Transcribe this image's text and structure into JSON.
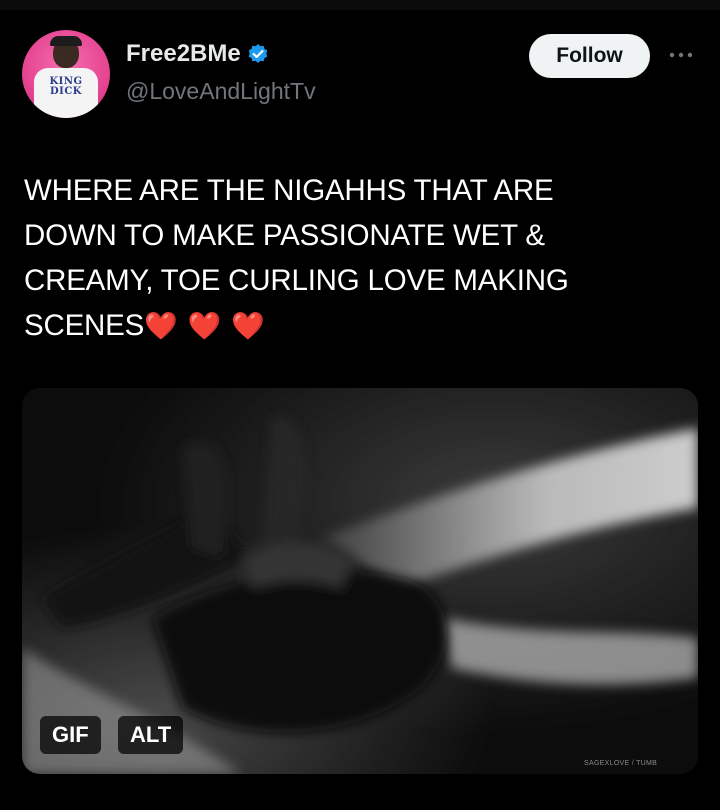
{
  "user": {
    "display_name": "Free2BMe",
    "handle": "@LoveAndLightTv",
    "verified": true,
    "avatar_shirt_text": "KING DICK"
  },
  "header": {
    "follow_label": "Follow",
    "more_icon": "more-horizontal-icon"
  },
  "tweet": {
    "lines": [
      "WHERE ARE THE NIGAHHS THAT ARE",
      "DOWN TO MAKE PASSIONATE WET &",
      "CREAMY, TOE CURLING LOVE MAKING",
      "SCENES"
    ],
    "emoji": "❤️❤️❤️"
  },
  "media": {
    "gif_label": "GIF",
    "alt_label": "ALT",
    "watermark": "SAGEXLOVE / TUMB"
  },
  "colors": {
    "background": "#000000",
    "verified_badge": "#1d9bf0",
    "handle": "#71767b",
    "follow_button_bg": "#eff3f4",
    "heart": "#e4202d"
  }
}
